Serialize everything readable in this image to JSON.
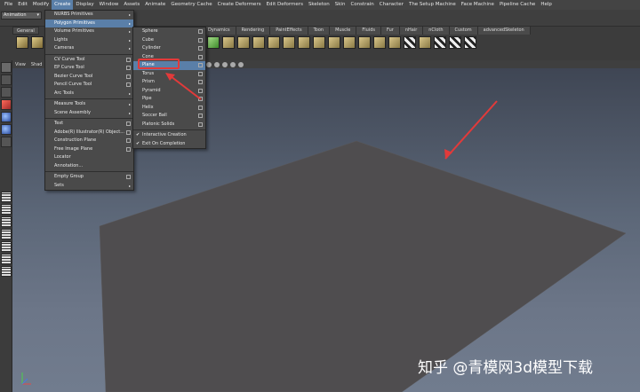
{
  "menubar": {
    "items": [
      "File",
      "Edit",
      "Modify",
      "Create",
      "Display",
      "Window",
      "Assets",
      "Animate",
      "Geometry Cache",
      "Create Deformers",
      "Edit Deformers",
      "Skeleton",
      "Skin",
      "Constrain",
      "Character",
      "The Setup Machine",
      "Face Machine",
      "Pipeline Cache",
      "Help"
    ],
    "active": "Create"
  },
  "mode_selector": {
    "value": "Animation"
  },
  "shelf": {
    "first_tab": "General",
    "tabs": [
      "Dynamics",
      "Rendering",
      "PaintEffects",
      "Toon",
      "Muscle",
      "Fluids",
      "Fur",
      "nHair",
      "nCloth",
      "Custom",
      "advancedSkeleton"
    ]
  },
  "panel_menu": {
    "items": [
      "View",
      "Shad"
    ]
  },
  "create_menu": {
    "items": [
      {
        "label": "NURBS Primitives",
        "submenu": true
      },
      {
        "label": "Polygon Primitives",
        "submenu": true,
        "highlighted": true
      },
      {
        "label": "Volume Primitives",
        "submenu": true
      },
      {
        "label": "Lights",
        "submenu": true
      },
      {
        "label": "Cameras",
        "submenu": true
      },
      {
        "label": "CV Curve Tool",
        "option": true
      },
      {
        "label": "EP Curve Tool",
        "option": true
      },
      {
        "label": "Bezier Curve Tool",
        "option": true
      },
      {
        "label": "Pencil Curve Tool",
        "option": true
      },
      {
        "label": "Arc Tools",
        "submenu": true
      },
      {
        "label": "Measure Tools",
        "submenu": true
      },
      {
        "label": "Scene Assembly",
        "submenu": true
      },
      {
        "label": "Text",
        "option": true
      },
      {
        "label": "Adobe(R) Illustrator(R) Object...",
        "option": true
      },
      {
        "label": "Construction Plane",
        "option": true
      },
      {
        "label": "Free Image Plane",
        "option": true
      },
      {
        "label": "Locator"
      },
      {
        "label": "Annotation..."
      },
      {
        "label": "Empty Group",
        "option": true
      },
      {
        "label": "Sets",
        "submenu": true
      }
    ]
  },
  "poly_menu": {
    "items": [
      {
        "label": "Sphere"
      },
      {
        "label": "Cube"
      },
      {
        "label": "Cylinder"
      },
      {
        "label": "Cone"
      },
      {
        "label": "Plane",
        "highlighted": true
      },
      {
        "label": "Torus"
      },
      {
        "label": "Prism"
      },
      {
        "label": "Pyramid"
      },
      {
        "label": "Pipe"
      },
      {
        "label": "Helix"
      },
      {
        "label": "Soccer Ball"
      },
      {
        "label": "Platonic Solids"
      },
      {
        "label": "Interactive Creation",
        "checked": true
      },
      {
        "label": "Exit On Completion",
        "checked": true
      }
    ]
  },
  "watermark": {
    "text": "知乎 @青模网3d模型下载"
  },
  "colors": {
    "menu_highlight": "#5a7fa8",
    "annotation_red": "#e23a3a",
    "plane": "#4f4d4f"
  }
}
